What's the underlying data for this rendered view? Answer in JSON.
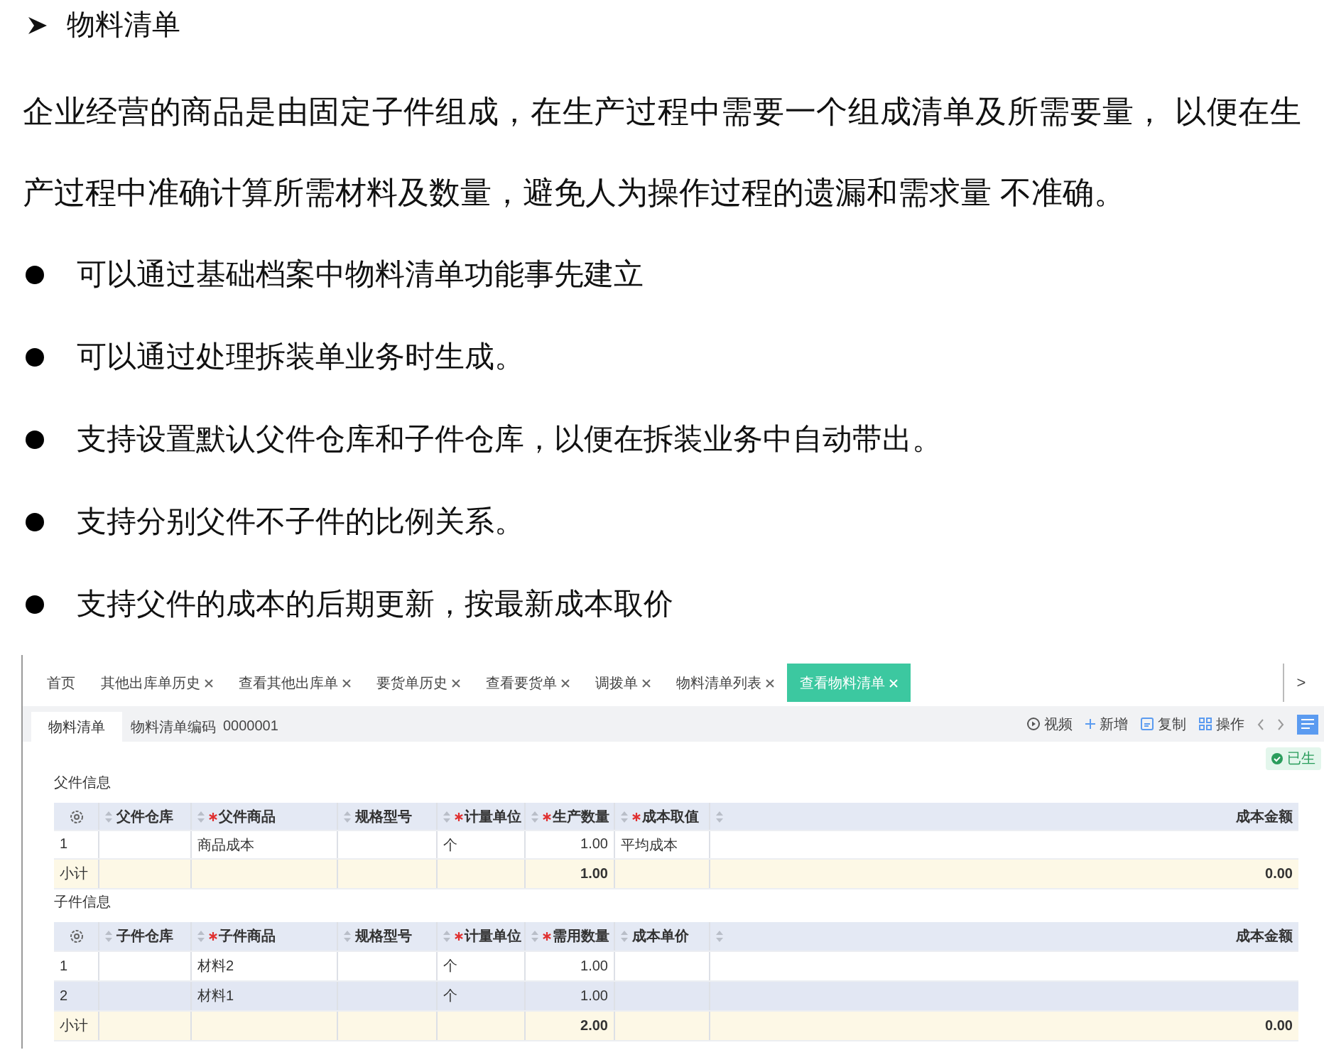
{
  "heading": {
    "text": "物料清单"
  },
  "paragraph_lines": [
    "企业经营的商品是由固定子件组成，在生产过程中需要一个组成清单及所需要量， 以便在生",
    "产过程中准确计算所需材料及数量，避免人为操作过程的遗漏和需求量 不准确。"
  ],
  "bullets": [
    "可以通过基础档案中物料清单功能事先建立",
    "可以通过处理拆装单业务时生成。",
    "支持设置默认父件仓库和子件仓库，以便在拆装业务中自动带出。",
    "支持分别父件不子件的比例关系。",
    "支持父件的成本的后期更新，按最新成本取价"
  ],
  "app": {
    "tabs": [
      {
        "label": "首页",
        "closable": false,
        "selected": false
      },
      {
        "label": "其他出库单历史",
        "closable": true,
        "selected": false
      },
      {
        "label": "查看其他出库单",
        "closable": true,
        "selected": false
      },
      {
        "label": "要货单历史",
        "closable": true,
        "selected": false
      },
      {
        "label": "查看要货单",
        "closable": true,
        "selected": false
      },
      {
        "label": "调拨单",
        "closable": true,
        "selected": false
      },
      {
        "label": "物料清单列表",
        "closable": true,
        "selected": false
      },
      {
        "label": "查看物料清单",
        "closable": true,
        "selected": true
      }
    ],
    "tab_scroll": ">",
    "subtab": {
      "label": "物料清单",
      "selected": true
    },
    "code_label": "物料清单编码",
    "code_value": "0000001",
    "toolbar": [
      {
        "kind": "video",
        "label": "视频"
      },
      {
        "kind": "add",
        "label": "新增"
      },
      {
        "kind": "copy",
        "label": "复制"
      },
      {
        "kind": "operate",
        "label": "操作"
      }
    ],
    "status_badge": "已生",
    "sections": [
      {
        "title": "父件信息",
        "columns": [
          {
            "label": "父件仓库",
            "required": false,
            "sortable": true,
            "kind": "text"
          },
          {
            "label": "父件商品",
            "required": true,
            "sortable": true,
            "kind": "text"
          },
          {
            "label": "规格型号",
            "required": false,
            "sortable": true,
            "kind": "text"
          },
          {
            "label": "计量单位",
            "required": true,
            "sortable": true,
            "kind": "text"
          },
          {
            "label": "生产数量",
            "required": true,
            "sortable": true,
            "kind": "number"
          },
          {
            "label": "成本取值",
            "required": true,
            "sortable": true,
            "kind": "text"
          },
          {
            "sortable": true,
            "kind": "blank"
          },
          {
            "label": "成本金额",
            "required": false,
            "sortable": false,
            "kind": "number"
          }
        ],
        "rows": [
          {
            "no": "1",
            "selected": false,
            "cells": [
              null,
              "商品成本",
              null,
              "个",
              "1.00",
              "平均成本",
              null,
              null
            ]
          }
        ],
        "subtotal": {
          "label": "小计",
          "cells": [
            null,
            null,
            null,
            null,
            "1.00",
            null,
            null,
            "0.00"
          ]
        }
      },
      {
        "title": "子件信息",
        "columns": [
          {
            "label": "子件仓库",
            "required": false,
            "sortable": true,
            "kind": "text"
          },
          {
            "label": "子件商品",
            "required": true,
            "sortable": true,
            "kind": "text"
          },
          {
            "label": "规格型号",
            "required": false,
            "sortable": true,
            "kind": "text"
          },
          {
            "label": "计量单位",
            "required": true,
            "sortable": true,
            "kind": "text"
          },
          {
            "label": "需用数量",
            "required": true,
            "sortable": true,
            "kind": "number"
          },
          {
            "label": "成本单价",
            "required": false,
            "sortable": true,
            "kind": "text"
          },
          {
            "sortable": true,
            "kind": "blank"
          },
          {
            "label": "成本金额",
            "required": false,
            "sortable": false,
            "kind": "number"
          }
        ],
        "rows": [
          {
            "no": "1",
            "selected": false,
            "cells": [
              null,
              "材料2",
              null,
              "个",
              "1.00",
              null,
              null,
              null
            ]
          },
          {
            "no": "2",
            "selected": true,
            "cells": [
              null,
              "材料1",
              null,
              "个",
              "1.00",
              null,
              null,
              null
            ]
          }
        ],
        "subtotal": {
          "label": "小计",
          "cells": [
            null,
            null,
            null,
            null,
            "2.00",
            null,
            null,
            "0.00"
          ]
        }
      }
    ]
  }
}
